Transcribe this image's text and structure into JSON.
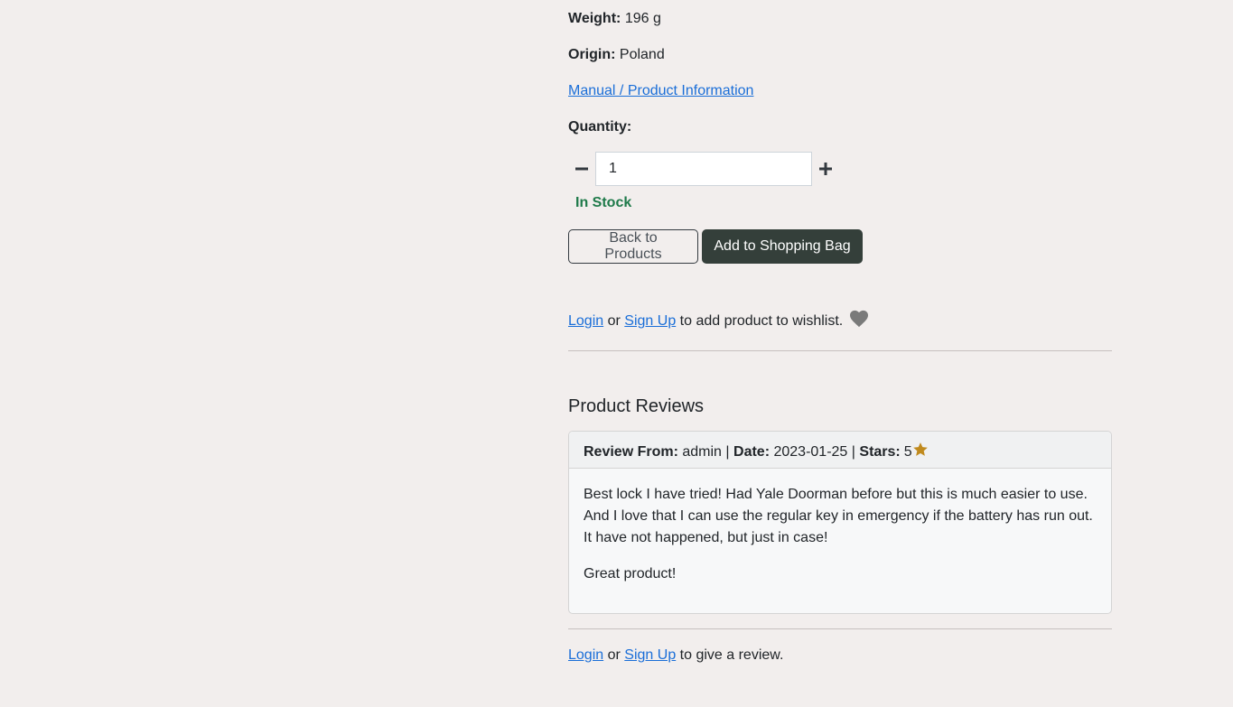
{
  "details": {
    "weight_label": "Weight:",
    "weight_value": "196 g",
    "origin_label": "Origin:",
    "origin_value": "Poland",
    "manual_link": "Manual / Product Information",
    "quantity_label": "Quantity:"
  },
  "quantity": {
    "value": "1",
    "decrement_icon": "minus-icon",
    "increment_icon": "plus-icon"
  },
  "stock_status": "In Stock",
  "buttons": {
    "back": "Back to Products",
    "add_to_bag": "Add to Shopping Bag"
  },
  "wishlist": {
    "login": "Login",
    "or": "or",
    "signup": "Sign Up",
    "suffix": "to add product to wishlist.",
    "icon": "heart-icon",
    "icon_color": "#7a7a7a"
  },
  "reviews": {
    "heading": "Product Reviews",
    "items": [
      {
        "from_label": "Review From:",
        "from_value": "admin",
        "sep1": "|",
        "date_label": "Date:",
        "date_value": "2023-01-25",
        "sep2": "|",
        "stars_label": "Stars:",
        "stars_value": "5",
        "star_icon": "star-icon",
        "star_color": "#c08a1e",
        "paragraphs": [
          "Best lock I have tried! Had Yale Doorman before but this is much easier to use. And I love that I can use the regular key in emergency if the battery has run out. It have not happened, but just in case!",
          "Great product!"
        ]
      }
    ]
  },
  "review_prompt": {
    "login": "Login",
    "or": "or",
    "signup": "Sign Up",
    "suffix": "to give a review."
  }
}
